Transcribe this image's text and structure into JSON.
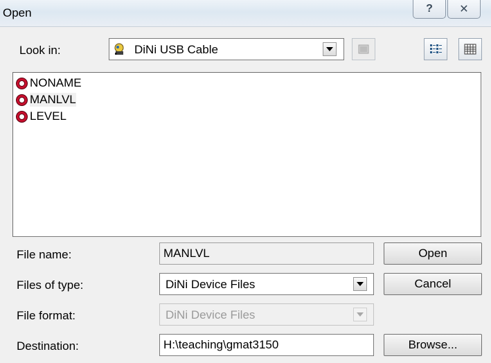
{
  "window": {
    "title": "Open",
    "help_glyph": "?",
    "close_glyph": "✕"
  },
  "look_in": {
    "label": "Look in:",
    "value": "DiNi USB Cable"
  },
  "files": [
    {
      "name": "NONAME",
      "selected": false
    },
    {
      "name": "MANLVL",
      "selected": true
    },
    {
      "name": "LEVEL",
      "selected": false
    }
  ],
  "file_name": {
    "label": "File name:",
    "value": "MANLVL"
  },
  "files_of_type": {
    "label": "Files of type:",
    "value": "DiNi Device Files"
  },
  "file_format": {
    "label": "File format:",
    "value": "DiNi Device Files"
  },
  "destination": {
    "label": "Destination:",
    "value": "H:\\teaching\\gmat3150"
  },
  "buttons": {
    "open": "Open",
    "cancel": "Cancel",
    "browse": "Browse..."
  }
}
